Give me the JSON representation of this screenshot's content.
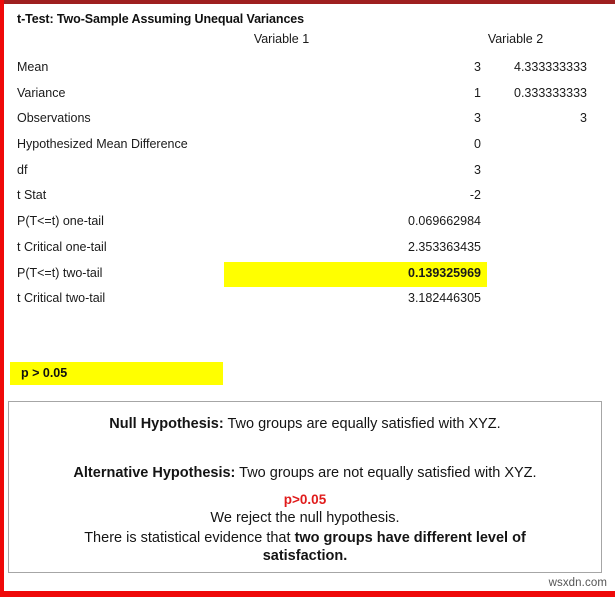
{
  "report": {
    "title": "t-Test: Two-Sample Assuming Unequal Variances",
    "columns": {
      "variable1": "Variable 1",
      "variable2": "Variable 2"
    },
    "rows": [
      {
        "label": "Mean",
        "v1": "3",
        "v2": "4.333333333",
        "highlight": false
      },
      {
        "label": "Variance",
        "v1": "1",
        "v2": "0.333333333",
        "highlight": false
      },
      {
        "label": "Observations",
        "v1": "3",
        "v2": "3",
        "highlight": false
      },
      {
        "label": "Hypothesized Mean Difference",
        "v1": "0",
        "v2": "",
        "highlight": false
      },
      {
        "label": "df",
        "v1": "3",
        "v2": "",
        "highlight": false
      },
      {
        "label": "t Stat",
        "v1": "-2",
        "v2": "",
        "highlight": false
      },
      {
        "label": "P(T<=t) one-tail",
        "v1": "0.069662984",
        "v2": "",
        "highlight": false
      },
      {
        "label": "t Critical one-tail",
        "v1": "2.353363435",
        "v2": "",
        "highlight": false
      },
      {
        "label": "P(T<=t) two-tail",
        "v1": "0.139325969",
        "v2": "",
        "highlight": true
      },
      {
        "label": "t Critical two-tail",
        "v1": "3.182446305",
        "v2": "",
        "highlight": false
      }
    ]
  },
  "callout": {
    "p_text": "p > 0.05",
    "highlight_color": "#ffff00"
  },
  "conclusion": {
    "null_lead": "Null Hypothesis:",
    "null_text": " Two groups are equally satisfied with XYZ.",
    "alt_lead": "Alternative Hypothesis:",
    "alt_text": " Two groups are not equally satisfied with XYZ.",
    "p_value_note": "p>0.05",
    "p_value_color": "#e01b1b",
    "decision": "We reject the null hypothesis.",
    "evidence_prefix": "There is statistical evidence that ",
    "evidence_bold": "two groups have different level of",
    "evidence_bold_line2": "satisfaction."
  },
  "watermark": "wsxdn.com",
  "frame": {
    "top_color": "#9e2020",
    "side_color": "#ef0909"
  }
}
